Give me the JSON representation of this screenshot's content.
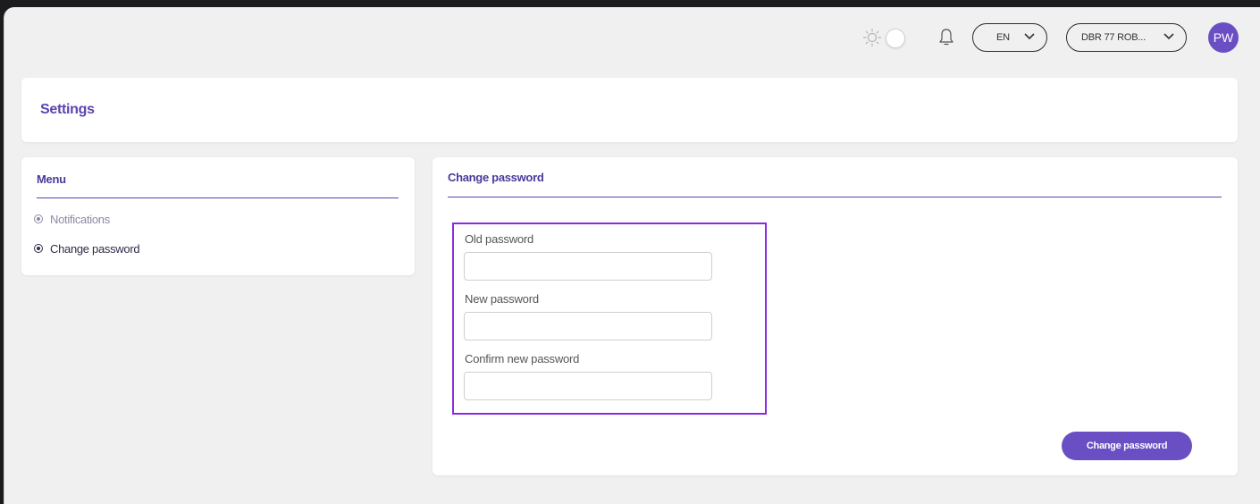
{
  "header": {
    "language": "EN",
    "company": "DBR 77 ROB...",
    "avatar_initials": "PW"
  },
  "page": {
    "title": "Settings"
  },
  "menu": {
    "title": "Menu",
    "items": [
      {
        "label": "Notifications",
        "active": false
      },
      {
        "label": "Change password",
        "active": true
      }
    ]
  },
  "change_password": {
    "title": "Change password",
    "fields": [
      {
        "label": "Old password",
        "value": ""
      },
      {
        "label": "New password",
        "value": ""
      },
      {
        "label": "Confirm new password",
        "value": ""
      }
    ],
    "submit_label": "Change password"
  },
  "colors": {
    "accent": "#6a4fc4",
    "title": "#5b43b2",
    "highlight_border": "#8a2be2",
    "background": "#f0f0f0"
  }
}
